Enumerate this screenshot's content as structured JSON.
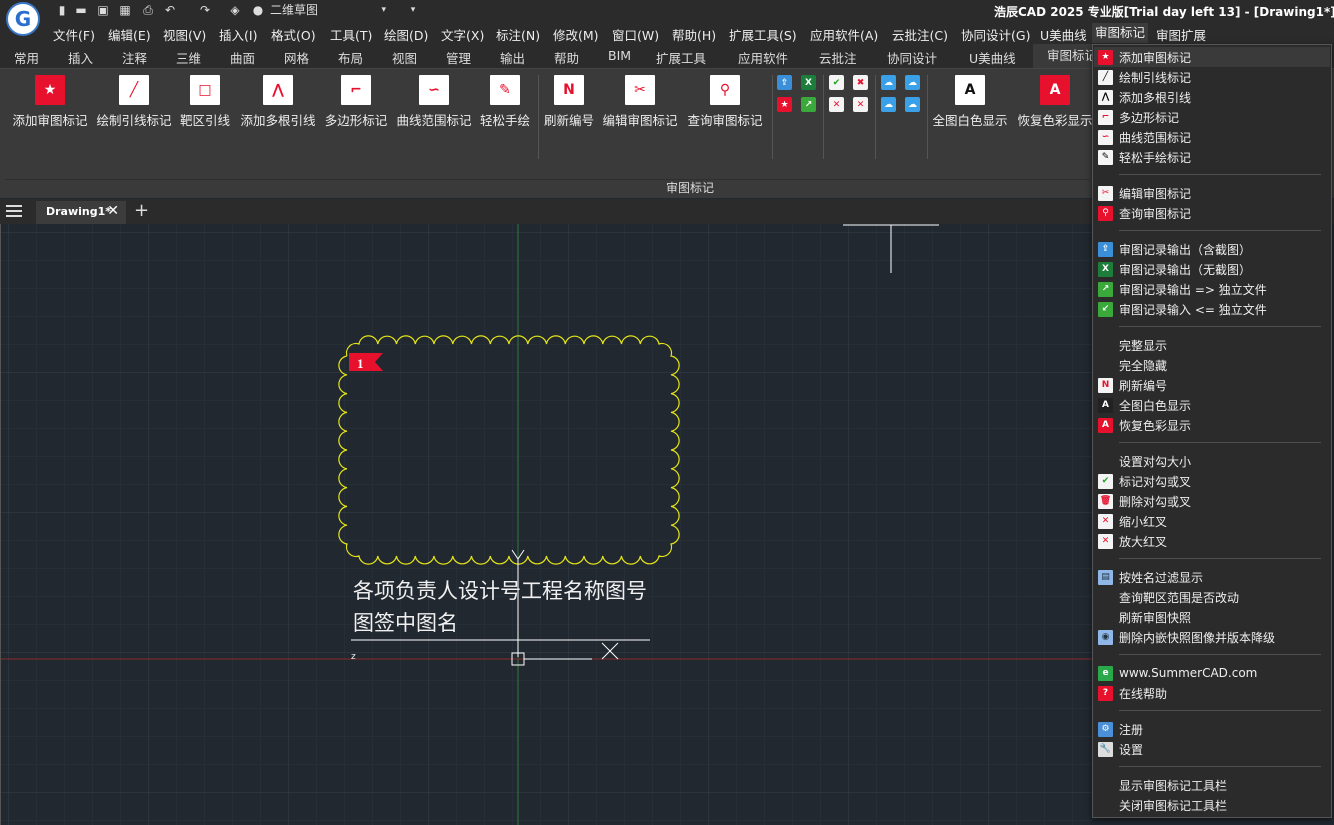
{
  "app": {
    "logo_letter": "G",
    "title": "浩辰CAD 2025 专业版[Trial day left 13] - [Drawing1*]",
    "workspace": "二维草图"
  },
  "quick_access": [
    {
      "name": "new-icon",
      "glyph": "▮"
    },
    {
      "name": "open-icon",
      "glyph": "▬"
    },
    {
      "name": "save-icon",
      "glyph": "▣"
    },
    {
      "name": "saveas-icon",
      "glyph": "▦"
    },
    {
      "name": "print-icon",
      "glyph": "⎙"
    },
    {
      "name": "undo-icon",
      "glyph": "↶"
    },
    {
      "name": "redo-icon",
      "glyph": "↷"
    },
    {
      "name": "layers-icon",
      "glyph": "◈"
    },
    {
      "name": "comment-icon",
      "glyph": "●"
    }
  ],
  "menu": [
    "文件(F)",
    "编辑(E)",
    "视图(V)",
    "插入(I)",
    "格式(O)",
    "工具(T)",
    "绘图(D)",
    "文字(X)",
    "标注(N)",
    "修改(M)",
    "窗口(W)",
    "帮助(H)",
    "扩展工具(S)",
    "应用软件(A)",
    "云批注(C)",
    "协同设计(G)",
    "U美曲线",
    "审图标记",
    "审图扩展"
  ],
  "ribbon_tabs": [
    "常用",
    "插入",
    "注释",
    "三维",
    "曲面",
    "网格",
    "布局",
    "视图",
    "管理",
    "输出",
    "帮助",
    "BIM",
    "扩展工具",
    "应用软件",
    "云批注",
    "协同设计",
    "U美曲线",
    "审图标记"
  ],
  "ribbon": {
    "panel_label": "审图标记",
    "buttons": [
      {
        "label": "添加审图标记",
        "icon": "add-mark-icon",
        "color": "#e8112d",
        "glyph": "★"
      },
      {
        "label": "绘制引线标记",
        "icon": "draw-leader-icon",
        "color": "#ffffff",
        "glyph": "╱"
      },
      {
        "label": "靶区引线",
        "icon": "target-leader-icon",
        "color": "#ffffff",
        "glyph": "□"
      },
      {
        "label": "添加多根引线",
        "icon": "multi-leader-icon",
        "color": "#ffffff",
        "glyph": "⋀"
      },
      {
        "label": "多边形标记",
        "icon": "polygon-mark-icon",
        "color": "#ffffff",
        "glyph": "⌐"
      },
      {
        "label": "曲线范围标记",
        "icon": "curve-mark-icon",
        "color": "#ffffff",
        "glyph": "∽"
      },
      {
        "label": "轻松手绘",
        "icon": "freehand-icon",
        "color": "#ffffff",
        "glyph": "✎"
      },
      {
        "label": "刷新编号",
        "icon": "refresh-number-icon",
        "color": "#ffffff",
        "glyph": "N"
      },
      {
        "label": "编辑审图标记",
        "icon": "edit-mark-icon",
        "color": "#ffffff",
        "glyph": "✂"
      },
      {
        "label": "查询审图标记",
        "icon": "query-mark-icon",
        "color": "#ffffff",
        "glyph": "⚲"
      },
      {
        "label": "全图白色显示",
        "icon": "white-display-icon",
        "color": "#ffffff",
        "glyph": "A"
      },
      {
        "label": "恢复色彩显示",
        "icon": "restore-color-icon",
        "color": "#e8112d",
        "glyph": "A"
      }
    ]
  },
  "doc_tab": {
    "title": "Drawing1*",
    "close": "✕",
    "add": "+"
  },
  "drawing": {
    "mark_number": "1",
    "note_text": "各项负责人设计号工程名称图号图签中图名",
    "z_label": "z"
  },
  "dropdown": [
    {
      "label": "添加审图标记",
      "icon": "add-mark-icon",
      "color": "#e8112d",
      "fg": "#fff",
      "glyph": "★",
      "highlight": true
    },
    {
      "label": "绘制引线标记",
      "icon": "draw-leader-icon",
      "color": "#f4f4f4",
      "fg": "#000",
      "glyph": "╱"
    },
    {
      "label": "添加多根引线",
      "icon": "multi-leader-icon",
      "color": "#f4f4f4",
      "fg": "#000",
      "glyph": "⋀"
    },
    {
      "label": "多边形标记",
      "icon": "polygon-mark-icon",
      "color": "#f4f4f4",
      "fg": "#e8112d",
      "glyph": "⌐"
    },
    {
      "label": "曲线范围标记",
      "icon": "curve-mark-icon",
      "color": "#f4f4f4",
      "fg": "#e8112d",
      "glyph": "∽"
    },
    {
      "label": "轻松手绘标记",
      "icon": "freehand-icon",
      "color": "#f4f4f4",
      "fg": "#000",
      "glyph": "✎"
    },
    {
      "sep": true
    },
    {
      "label": "编辑审图标记",
      "icon": "edit-mark-icon",
      "color": "#f4f4f4",
      "fg": "#e8112d",
      "glyph": "✂"
    },
    {
      "label": "查询审图标记",
      "icon": "query-mark-icon",
      "color": "#e8112d",
      "fg": "#fff",
      "glyph": "⚲"
    },
    {
      "sep": true
    },
    {
      "label": "审图记录输出（含截图）",
      "icon": "export-with-shot-icon",
      "color": "#3a8fd8",
      "fg": "#fff",
      "glyph": "⇪"
    },
    {
      "label": "审图记录输出（无截图）",
      "icon": "export-excel-icon",
      "color": "#1d7d3a",
      "fg": "#fff",
      "glyph": "X"
    },
    {
      "label": "审图记录输出 => 独立文件",
      "icon": "export-file-icon",
      "color": "#3aa83a",
      "fg": "#fff",
      "glyph": "↗"
    },
    {
      "label": "审图记录输入 <= 独立文件",
      "icon": "import-file-icon",
      "color": "#3aa83a",
      "fg": "#fff",
      "glyph": "↙"
    },
    {
      "sep": true
    },
    {
      "label": "完整显示",
      "icon": "",
      "color": "",
      "fg": "",
      "glyph": ""
    },
    {
      "label": "完全隐藏",
      "icon": "",
      "color": "",
      "fg": "",
      "glyph": ""
    },
    {
      "label": "刷新编号",
      "icon": "refresh-number-icon",
      "color": "#f4f4f4",
      "fg": "#e8112d",
      "glyph": "N"
    },
    {
      "label": "全图白色显示",
      "icon": "white-display-icon",
      "color": "#222",
      "fg": "#fff",
      "glyph": "A"
    },
    {
      "label": "恢复色彩显示",
      "icon": "restore-color-icon",
      "color": "#e8112d",
      "fg": "#fff",
      "glyph": "A"
    },
    {
      "sep": true
    },
    {
      "label": "设置对勾大小",
      "icon": "",
      "color": "",
      "fg": "",
      "glyph": ""
    },
    {
      "label": "标记对勾或叉",
      "icon": "check-mark-icon",
      "color": "#f4f4f4",
      "fg": "#1aa51a",
      "glyph": "✔"
    },
    {
      "label": "删除对勾或叉",
      "icon": "delete-check-icon",
      "color": "#f4f4f4",
      "fg": "#e8112d",
      "glyph": "🗑"
    },
    {
      "label": "缩小红叉",
      "icon": "shrink-cross-icon",
      "color": "#f4f4f4",
      "fg": "#e8112d",
      "glyph": "✕"
    },
    {
      "label": "放大红叉",
      "icon": "enlarge-cross-icon",
      "color": "#f4f4f4",
      "fg": "#e8112d",
      "glyph": "✕"
    },
    {
      "sep": true
    },
    {
      "label": "按姓名过滤显示",
      "icon": "filter-name-icon",
      "color": "#8fb8e8",
      "fg": "#234",
      "glyph": "▤"
    },
    {
      "label": "查询靶区范围是否改动",
      "icon": "",
      "color": "",
      "fg": "",
      "glyph": ""
    },
    {
      "label": "刷新审图快照",
      "icon": "",
      "color": "",
      "fg": "",
      "glyph": ""
    },
    {
      "label": "删除内嵌快照图像并版本降级",
      "icon": "camera-icon",
      "color": "#8fb8e8",
      "fg": "#234",
      "glyph": "◉"
    },
    {
      "sep": true
    },
    {
      "label": "www.SummerCAD.com",
      "icon": "ie-icon",
      "color": "#2aa84a",
      "fg": "#fff",
      "glyph": "e"
    },
    {
      "label": "在线帮助",
      "icon": "help-book-icon",
      "color": "#e8112d",
      "fg": "#fff",
      "glyph": "?"
    },
    {
      "sep": true
    },
    {
      "label": "注册",
      "icon": "register-icon",
      "color": "#4a8fd8",
      "fg": "#fff",
      "glyph": "⚙"
    },
    {
      "label": "设置",
      "icon": "settings-icon",
      "color": "#ddd",
      "fg": "#333",
      "glyph": "🔧"
    },
    {
      "sep": true
    },
    {
      "label": "显示审图标记工具栏",
      "icon": "",
      "color": "",
      "fg": "",
      "glyph": ""
    },
    {
      "label": "关闭审图标记工具栏",
      "icon": "",
      "color": "",
      "fg": "",
      "glyph": ""
    }
  ]
}
